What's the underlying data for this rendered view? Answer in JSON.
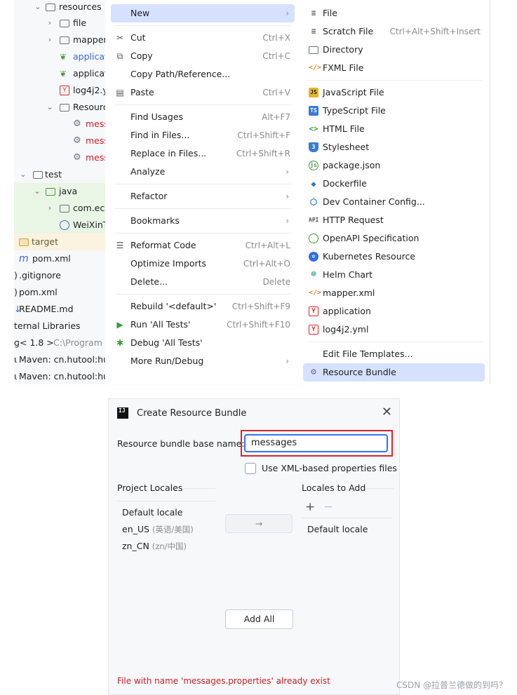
{
  "tree": {
    "items": [
      {
        "label": "resources",
        "kind": "folder-yellow"
      },
      {
        "label": "file",
        "kind": "folder"
      },
      {
        "label": "mapper",
        "kind": "folder"
      },
      {
        "label": "applicat",
        "kind": "spring"
      },
      {
        "label": "applicat",
        "kind": "spring"
      },
      {
        "label": "log4j2.y",
        "kind": "yaml"
      },
      {
        "label": "Resourc",
        "kind": "bundle"
      },
      {
        "label": "mess",
        "kind": "gear"
      },
      {
        "label": "mess",
        "kind": "gear"
      },
      {
        "label": "mess",
        "kind": "gear"
      },
      {
        "label": "test",
        "kind": "folder"
      },
      {
        "label": "java",
        "kind": "folder-green"
      },
      {
        "label": "com.ech",
        "kind": "package"
      },
      {
        "label": "WeiXinT",
        "kind": "class"
      },
      {
        "label": "target",
        "kind": "folder-yellow"
      },
      {
        "label": "pom.xml",
        "kind": "maven"
      },
      {
        "label": ".gitignore",
        "kind": "file"
      },
      {
        "label": "pom.xml",
        "kind": "file"
      },
      {
        "label": "README.md",
        "kind": "md"
      },
      {
        "label": "ternal Libraries",
        "kind": "none"
      },
      {
        "label": "< 1.8 >",
        "extra": "C:\\Program F",
        "kind": "lib"
      },
      {
        "label": "Maven: cn.hutool:huto",
        "kind": "lib"
      },
      {
        "label": "Maven: cn.hutool:huto",
        "kind": "lib"
      }
    ]
  },
  "menu": {
    "items": [
      {
        "label": "New",
        "arrow": true
      },
      {
        "label": "Cut",
        "shortcut": "Ctrl+X",
        "icon": "scissors-icon"
      },
      {
        "label": "Copy",
        "shortcut": "Ctrl+C",
        "icon": "copy-icon"
      },
      {
        "label": "Copy Path/Reference..."
      },
      {
        "label": "Paste",
        "shortcut": "Ctrl+V",
        "icon": "paste-icon"
      },
      {
        "label": "Find Usages",
        "shortcut": "Alt+F7"
      },
      {
        "label": "Find in Files...",
        "shortcut": "Ctrl+Shift+F"
      },
      {
        "label": "Replace in Files...",
        "shortcut": "Ctrl+Shift+R"
      },
      {
        "label": "Analyze",
        "arrow": true
      },
      {
        "label": "Refactor",
        "arrow": true
      },
      {
        "label": "Bookmarks",
        "arrow": true
      },
      {
        "label": "Reformat Code",
        "shortcut": "Ctrl+Alt+L",
        "icon": "reformat-icon"
      },
      {
        "label": "Optimize Imports",
        "shortcut": "Ctrl+Alt+O"
      },
      {
        "label": "Delete...",
        "shortcut": "Delete"
      },
      {
        "label": "Rebuild '<default>'",
        "shortcut": "Ctrl+Shift+F9"
      },
      {
        "label": "Run 'All Tests'",
        "shortcut": "Ctrl+Shift+F10",
        "icon": "run-icon"
      },
      {
        "label": "Debug 'All Tests'",
        "icon": "debug-icon"
      },
      {
        "label": "More Run/Debug",
        "arrow": true
      }
    ]
  },
  "submenu": {
    "items": [
      {
        "label": "File",
        "icon": "file-icon"
      },
      {
        "label": "Scratch File",
        "shortcut": "Ctrl+Alt+Shift+Insert",
        "icon": "scratch-icon"
      },
      {
        "label": "Directory",
        "icon": "folder-icon"
      },
      {
        "label": "FXML File",
        "icon": "xml-icon"
      },
      {
        "label": "JavaScript File",
        "icon": "javascript-icon",
        "badge": "JS"
      },
      {
        "label": "TypeScript File",
        "icon": "typescript-icon",
        "badge": "TS"
      },
      {
        "label": "HTML File",
        "icon": "html-icon"
      },
      {
        "label": "Stylesheet",
        "icon": "css-icon"
      },
      {
        "label": "package.json",
        "icon": "nodejs-icon"
      },
      {
        "label": "Dockerfile",
        "icon": "docker-icon"
      },
      {
        "label": "Dev Container Config...",
        "icon": "container-icon"
      },
      {
        "label": "HTTP Request",
        "icon": "api-icon",
        "badge": "API"
      },
      {
        "label": "OpenAPI Specification",
        "icon": "openapi-icon"
      },
      {
        "label": "Kubernetes Resource",
        "icon": "kubernetes-icon"
      },
      {
        "label": "Helm Chart",
        "icon": "helm-icon"
      },
      {
        "label": "mapper.xml",
        "icon": "xml-icon"
      },
      {
        "label": "application",
        "icon": "yaml-icon",
        "badge": "Y"
      },
      {
        "label": "log4j2.yml",
        "icon": "yaml-icon",
        "badge": "Y"
      },
      {
        "label": "Edit File Templates..."
      },
      {
        "label": "Resource Bundle",
        "icon": "gear-icon"
      }
    ]
  },
  "dialog": {
    "title": "Create Resource Bundle",
    "base_name_label": "Resource bundle base name:",
    "base_name_value": "messages",
    "xml_checkbox_label": "Use XML-based properties files",
    "project_locales_label": "Project Locales",
    "locales_to_add_label": "Locales to Add",
    "project_locales": [
      {
        "code": "Default locale",
        "desc": ""
      },
      {
        "code": "en_US",
        "desc": "(英语/美国)"
      },
      {
        "code": "zn_CN",
        "desc": "(zn/中国)"
      }
    ],
    "locales_to_add": [
      "Default locale"
    ],
    "add_all_label": "Add All",
    "move_arrow": "→",
    "error_text": "File with name 'messages.properties' already exist"
  },
  "watermark": "CSDN @拉普兰德做的到吗？",
  "colors": {
    "highlight": "#d5e1ff",
    "error": "#c7222a",
    "input_focus": "#3574f0",
    "annotation_box": "#d9262b"
  }
}
